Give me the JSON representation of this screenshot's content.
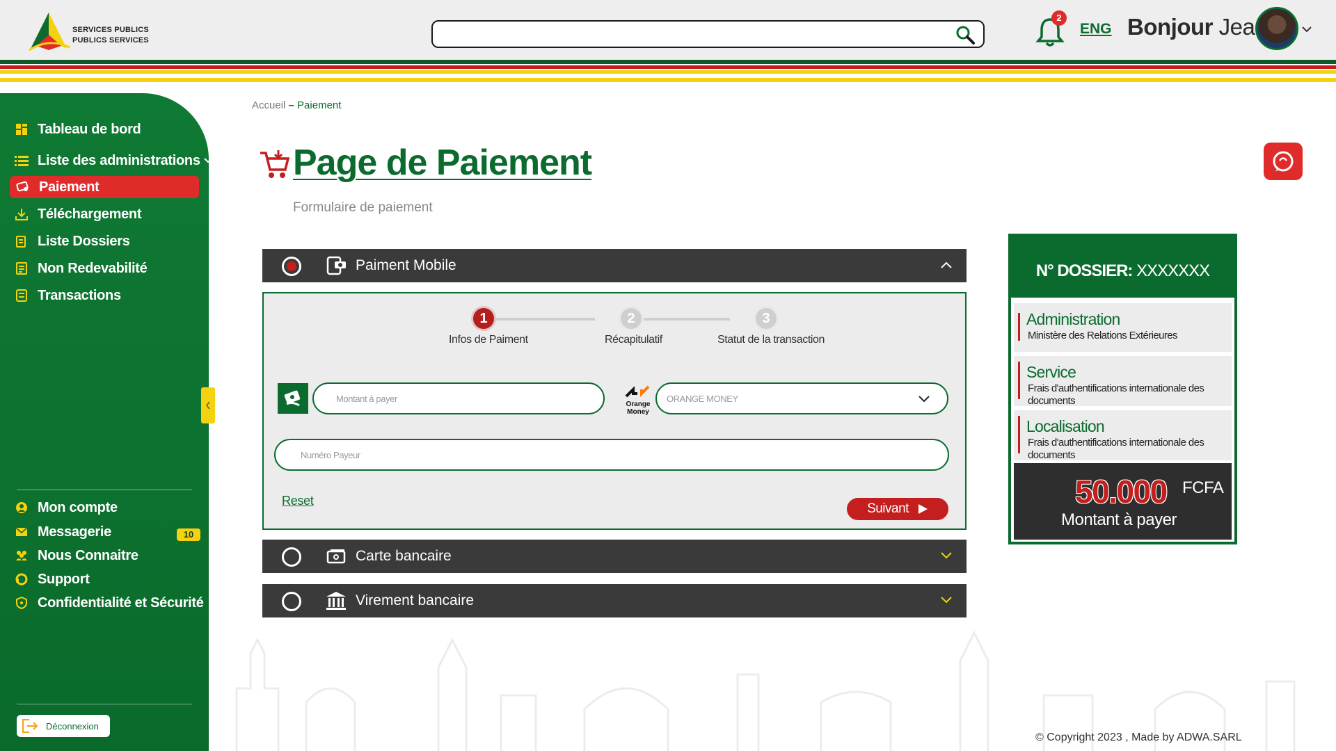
{
  "header": {
    "logo_line1": "SERVICES PUBLICS",
    "logo_line2": "PUBLICS SERVICES",
    "search_value": "",
    "notification_count": "2",
    "language": "ENG",
    "greeting_prefix": "Bonjour",
    "greeting_name": "Jean"
  },
  "sidebar": {
    "items": [
      {
        "label": "Tableau de bord"
      },
      {
        "label": "Liste des administrations"
      },
      {
        "label": "Paiement"
      },
      {
        "label": "Téléchargement"
      },
      {
        "label": "Liste Dossiers"
      },
      {
        "label": "Non Redevabilité"
      },
      {
        "label": "Transactions"
      }
    ],
    "bottom_items": [
      {
        "label": "Mon compte"
      },
      {
        "label": "Messagerie"
      },
      {
        "label": "Nous Connaitre"
      },
      {
        "label": "Support"
      },
      {
        "label": "Confidentialité et Sécurité"
      }
    ],
    "messages_badge": "10",
    "logout_label": "Déconnexion"
  },
  "breadcrumb": {
    "home": "Accueil",
    "separator": "–",
    "current": "Paiement"
  },
  "page": {
    "title": "Page de Paiement",
    "subtitle": "Formulaire de paiement"
  },
  "payment_methods": [
    {
      "label": "Paiment Mobile"
    },
    {
      "label": "Carte bancaire"
    },
    {
      "label": "Virement bancaire"
    }
  ],
  "steps": [
    {
      "number": "1",
      "label": "Infos de Paiment"
    },
    {
      "number": "2",
      "label": "Récapitulatif"
    },
    {
      "number": "3",
      "label": "Statut de la transaction"
    }
  ],
  "form": {
    "amount_placeholder": "Montant à payer",
    "operator_logo_line1": "Orange",
    "operator_logo_line2": "Money",
    "operator_selected": "ORANGE MONEY",
    "payer_number_placeholder": "Numéro Payeur",
    "reset_label": "Reset",
    "next_label": "Suivant"
  },
  "dossier": {
    "label": "N° DOSSIER:",
    "number": "XXXXXXX",
    "administration_title": "Administration",
    "administration_value": "Ministère des Relations Extérieures",
    "service_title": "Service",
    "service_value": "Frais d'authentifications internationale des documents",
    "location_title": "Localisation",
    "location_value": "Frais d'authentifications internationale des documents",
    "amount": "50.000",
    "currency": "FCFA",
    "amount_label": "Montant à payer"
  },
  "footer": {
    "copyright": "© Copyright 2023 , Made by",
    "company": "ADWA.SARL"
  },
  "colors": {
    "green": "#0b6b2f",
    "red": "#e02b2b",
    "yellow": "#f4d20f",
    "dark": "#3a3a3a"
  }
}
